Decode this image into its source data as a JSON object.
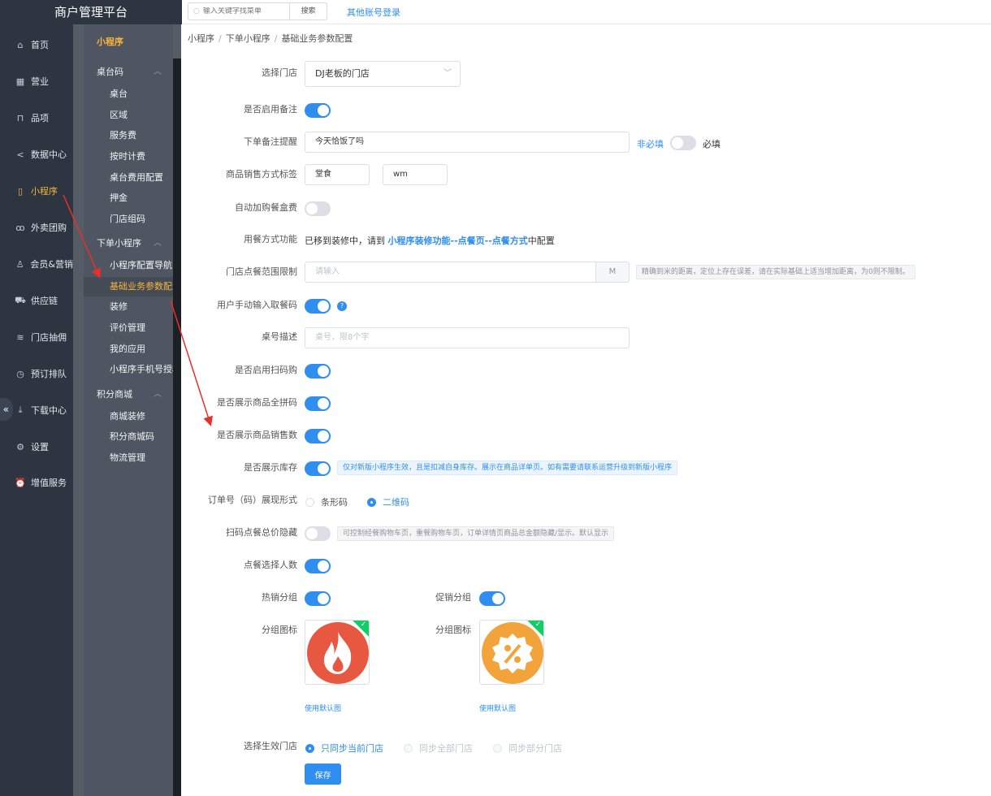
{
  "app": {
    "title": "商户管理平台"
  },
  "topbar": {
    "search_placeholder": "输入关键字找菜单",
    "search_label": "搜索",
    "other_login": "其他账号登录"
  },
  "main_nav": [
    {
      "label": "首页",
      "icon": "home-icon"
    },
    {
      "label": "营业",
      "icon": "calendar-icon"
    },
    {
      "label": "品项",
      "icon": "bag-icon"
    },
    {
      "label": "数据中心",
      "icon": "share-icon"
    },
    {
      "label": "小程序",
      "icon": "tablet-icon"
    },
    {
      "label": "外卖团购",
      "icon": "bike-icon"
    },
    {
      "label": "会员&营销",
      "icon": "user-icon"
    },
    {
      "label": "供应链",
      "icon": "truck-icon"
    },
    {
      "label": "门店抽佣",
      "icon": "database-icon"
    },
    {
      "label": "预订排队",
      "icon": "clock-icon"
    },
    {
      "label": "下载中心",
      "icon": "download-icon"
    },
    {
      "label": "设置",
      "icon": "gear-icon"
    },
    {
      "label": "增值服务",
      "icon": "alarm-icon"
    }
  ],
  "sub_nav": {
    "title": "小程序",
    "groups": [
      {
        "label": "桌台码",
        "items": [
          "桌台",
          "区域",
          "服务费",
          "按时计费",
          "桌台费用配置",
          "押金",
          "门店组码"
        ]
      },
      {
        "label": "下单小程序",
        "items": [
          "小程序配置导航",
          "基础业务参数配置",
          "装修",
          "评价管理",
          "我的应用",
          "小程序手机号授权"
        ]
      },
      {
        "label": "积分商城",
        "items": [
          "商城装修",
          "积分商城码",
          "物流管理"
        ]
      }
    ]
  },
  "breadcrumb": [
    "小程序",
    "下单小程序",
    "基础业务参数配置"
  ],
  "form": {
    "store_label": "选择门店",
    "store_value": "DJ老板的门店",
    "remark_enable_label": "是否启用备注",
    "remark_tip_label": "下单备注提醒",
    "remark_tip_value": "今天恰饭了吗",
    "remark_optional": "非必填",
    "remark_required": "必填",
    "sale_tag_label": "商品销售方式标签",
    "sale_tag_1": "堂食",
    "sale_tag_2": "wm",
    "auto_box_label": "自动加购餐盒费",
    "dining_label": "用餐方式功能",
    "dining_text_pre": "已移到装修中，请到 ",
    "dining_link": "小程序装修功能--点餐页--点餐方式",
    "dining_text_post": "中配置",
    "range_label": "门店点餐范围限制",
    "range_placeholder": "请输入",
    "range_unit": "M",
    "range_tip": "精确到米的距离，定位上存在误差，请在实际基础上适当增加距离，为0则不限制。",
    "manual_code_label": "用户手动输入取餐码",
    "table_desc_label": "桌号描述",
    "table_desc_placeholder": "桌号，限8个字",
    "scan_buy_label": "是否启用扫码购",
    "show_pinyin_label": "是否展示商品全拼码",
    "show_sales_label": "是否展示商品销售数",
    "show_stock_label": "是否展示库存",
    "show_stock_tip": "仅对新版小程序生效，且是扣减自身库存。展示在商品详单页。如有需要请联系运营升级到新版小程序",
    "order_code_label": "订单号（码）展现形式",
    "order_code_barcode": "条形码",
    "order_code_qrcode": "二维码",
    "hide_total_label": "扫码点餐总价隐藏",
    "hide_total_tip": "可控制经餐购物车页，重餐购物车页，订单详情页商品总金额隐藏/显示。默认显示",
    "people_label": "点餐选择人数",
    "hot_group_label": "热销分组",
    "promo_group_label": "促销分组",
    "group_icon_label": "分组图标",
    "group_icon_label2": "分组图标",
    "use_default": "使用默认图",
    "use_default2": "使用默认图",
    "effect_label": "选择生效门店",
    "effect_opt1": "只同步当前门店",
    "effect_opt2": "同步全部门店",
    "effect_opt3": "同步部分门店",
    "save": "保存"
  },
  "colors": {
    "primary": "#2f8ef0",
    "sidebar": "#2d3541",
    "subnav": "#555c66",
    "active": "#f5b53f",
    "hot_icon": "#e8573f",
    "promo_icon": "#f2a33a"
  }
}
